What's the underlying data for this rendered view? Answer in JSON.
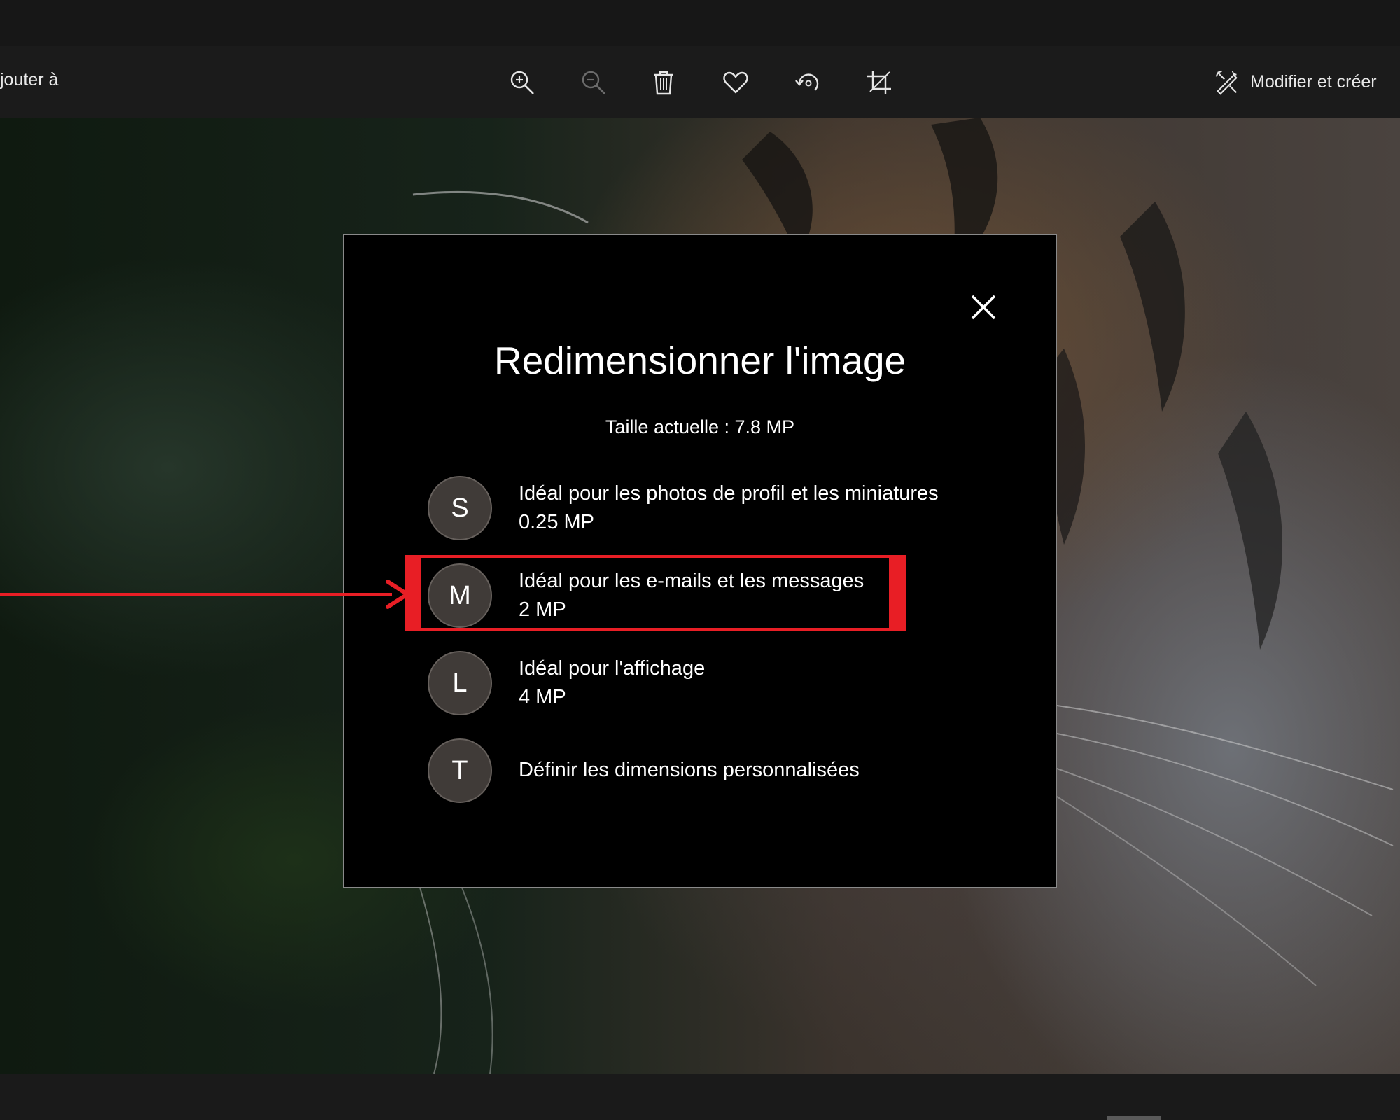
{
  "toolbar": {
    "left_label": "jouter à",
    "right_label": "Modifier et créer",
    "icons": [
      "zoom-in-icon",
      "zoom-out-icon",
      "trash-icon",
      "heart-icon",
      "rotate-icon",
      "crop-icon",
      "edit-create-icon"
    ]
  },
  "dialog": {
    "title": "Redimensionner l'image",
    "subtitle": "Taille actuelle : 7.8 MP",
    "options": [
      {
        "letter": "S",
        "line1": "Idéal pour les photos de profil et les miniatures",
        "line2": "0.25 MP"
      },
      {
        "letter": "M",
        "line1": "Idéal pour les e-mails et les messages",
        "line2": "2 MP"
      },
      {
        "letter": "L",
        "line1": "Idéal pour l'affichage",
        "line2": "4 MP"
      },
      {
        "letter": "T",
        "line1": "Définir les dimensions personnalisées"
      }
    ]
  },
  "colors": {
    "annotation": "#e81e25",
    "dialog_bg": "#000000",
    "circle_bg": "#403b38"
  }
}
